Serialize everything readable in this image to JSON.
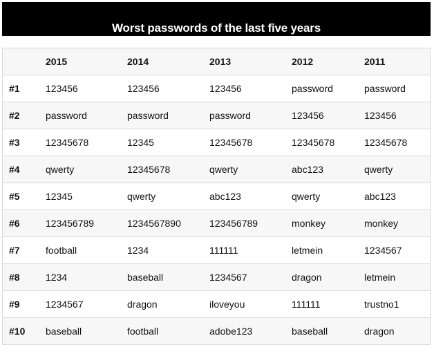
{
  "title": "Worst passwords of the last five years",
  "table": {
    "headers": [
      "",
      "2015",
      "2014",
      "2013",
      "2012",
      "2011"
    ],
    "rows": [
      [
        "#1",
        "123456",
        "123456",
        "123456",
        "password",
        "password"
      ],
      [
        "#2",
        "password",
        "password",
        "password",
        "123456",
        "123456"
      ],
      [
        "#3",
        "12345678",
        "12345",
        "12345678",
        "12345678",
        "12345678"
      ],
      [
        "#4",
        "qwerty",
        "12345678",
        "qwerty",
        "abc123",
        "qwerty"
      ],
      [
        "#5",
        "12345",
        "qwerty",
        "abc123",
        "qwerty",
        "abc123"
      ],
      [
        "#6",
        "123456789",
        "1234567890",
        "123456789",
        "monkey",
        "monkey"
      ],
      [
        "#7",
        "football",
        "1234",
        "111111",
        "letmein",
        "1234567"
      ],
      [
        "#8",
        "1234",
        "baseball",
        "1234567",
        "dragon",
        "letmein"
      ],
      [
        "#9",
        "1234567",
        "dragon",
        "iloveyou",
        "111111",
        "trustno1"
      ],
      [
        "#10",
        "baseball",
        "football",
        "adobe123",
        "baseball",
        "dragon"
      ]
    ]
  }
}
